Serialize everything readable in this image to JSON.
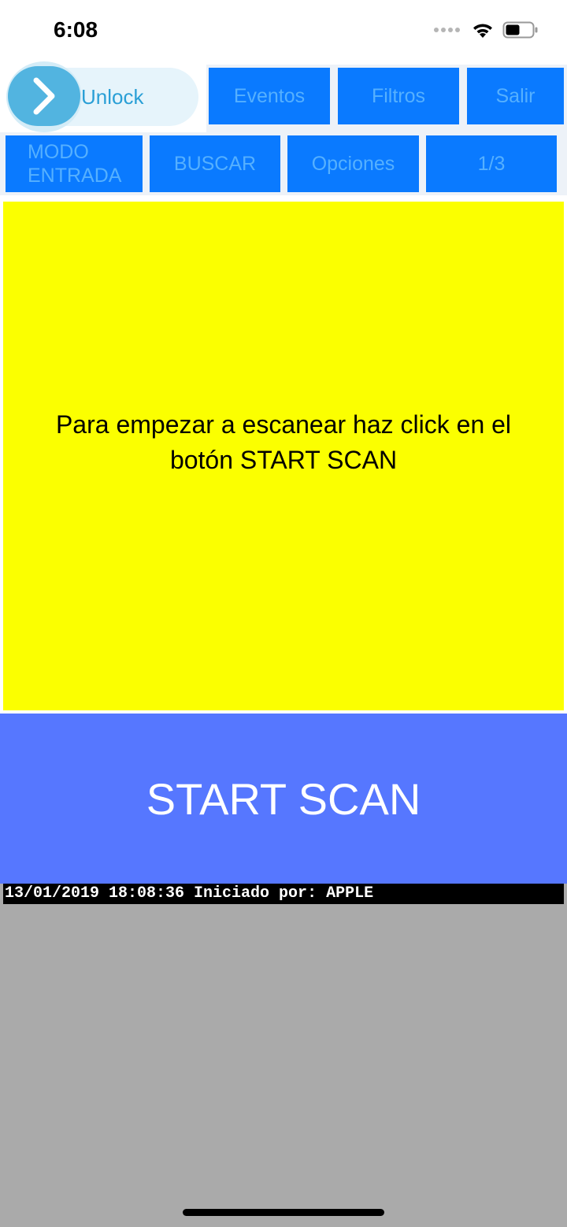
{
  "status_bar": {
    "time": "6:08",
    "icons": [
      "cellular-signal-icon",
      "wifi-icon",
      "battery-icon"
    ]
  },
  "unlock": {
    "label": "Unlock",
    "icon": "chevron-right-icon"
  },
  "top_buttons": {
    "eventos": "Eventos",
    "filtros": "Filtros",
    "salir": "Salir"
  },
  "second_row_buttons": {
    "modo_line1": "MODO",
    "modo_line2": "ENTRADA",
    "buscar": "BUSCAR",
    "opciones": "Opciones",
    "page": "1/3"
  },
  "panel": {
    "message": "Para empezar a escanear haz click en el botón START SCAN"
  },
  "scan_button": {
    "label": "START SCAN"
  },
  "log": {
    "entries": [
      "13/01/2019 18:08:36 Iniciado por: APPLE"
    ]
  },
  "colors": {
    "button_blue": "#0a7aff",
    "button_text": "#55b0ff",
    "panel_yellow": "#fbff00",
    "scan_blue": "#5677ff",
    "log_bg": "#aaaaaa"
  }
}
